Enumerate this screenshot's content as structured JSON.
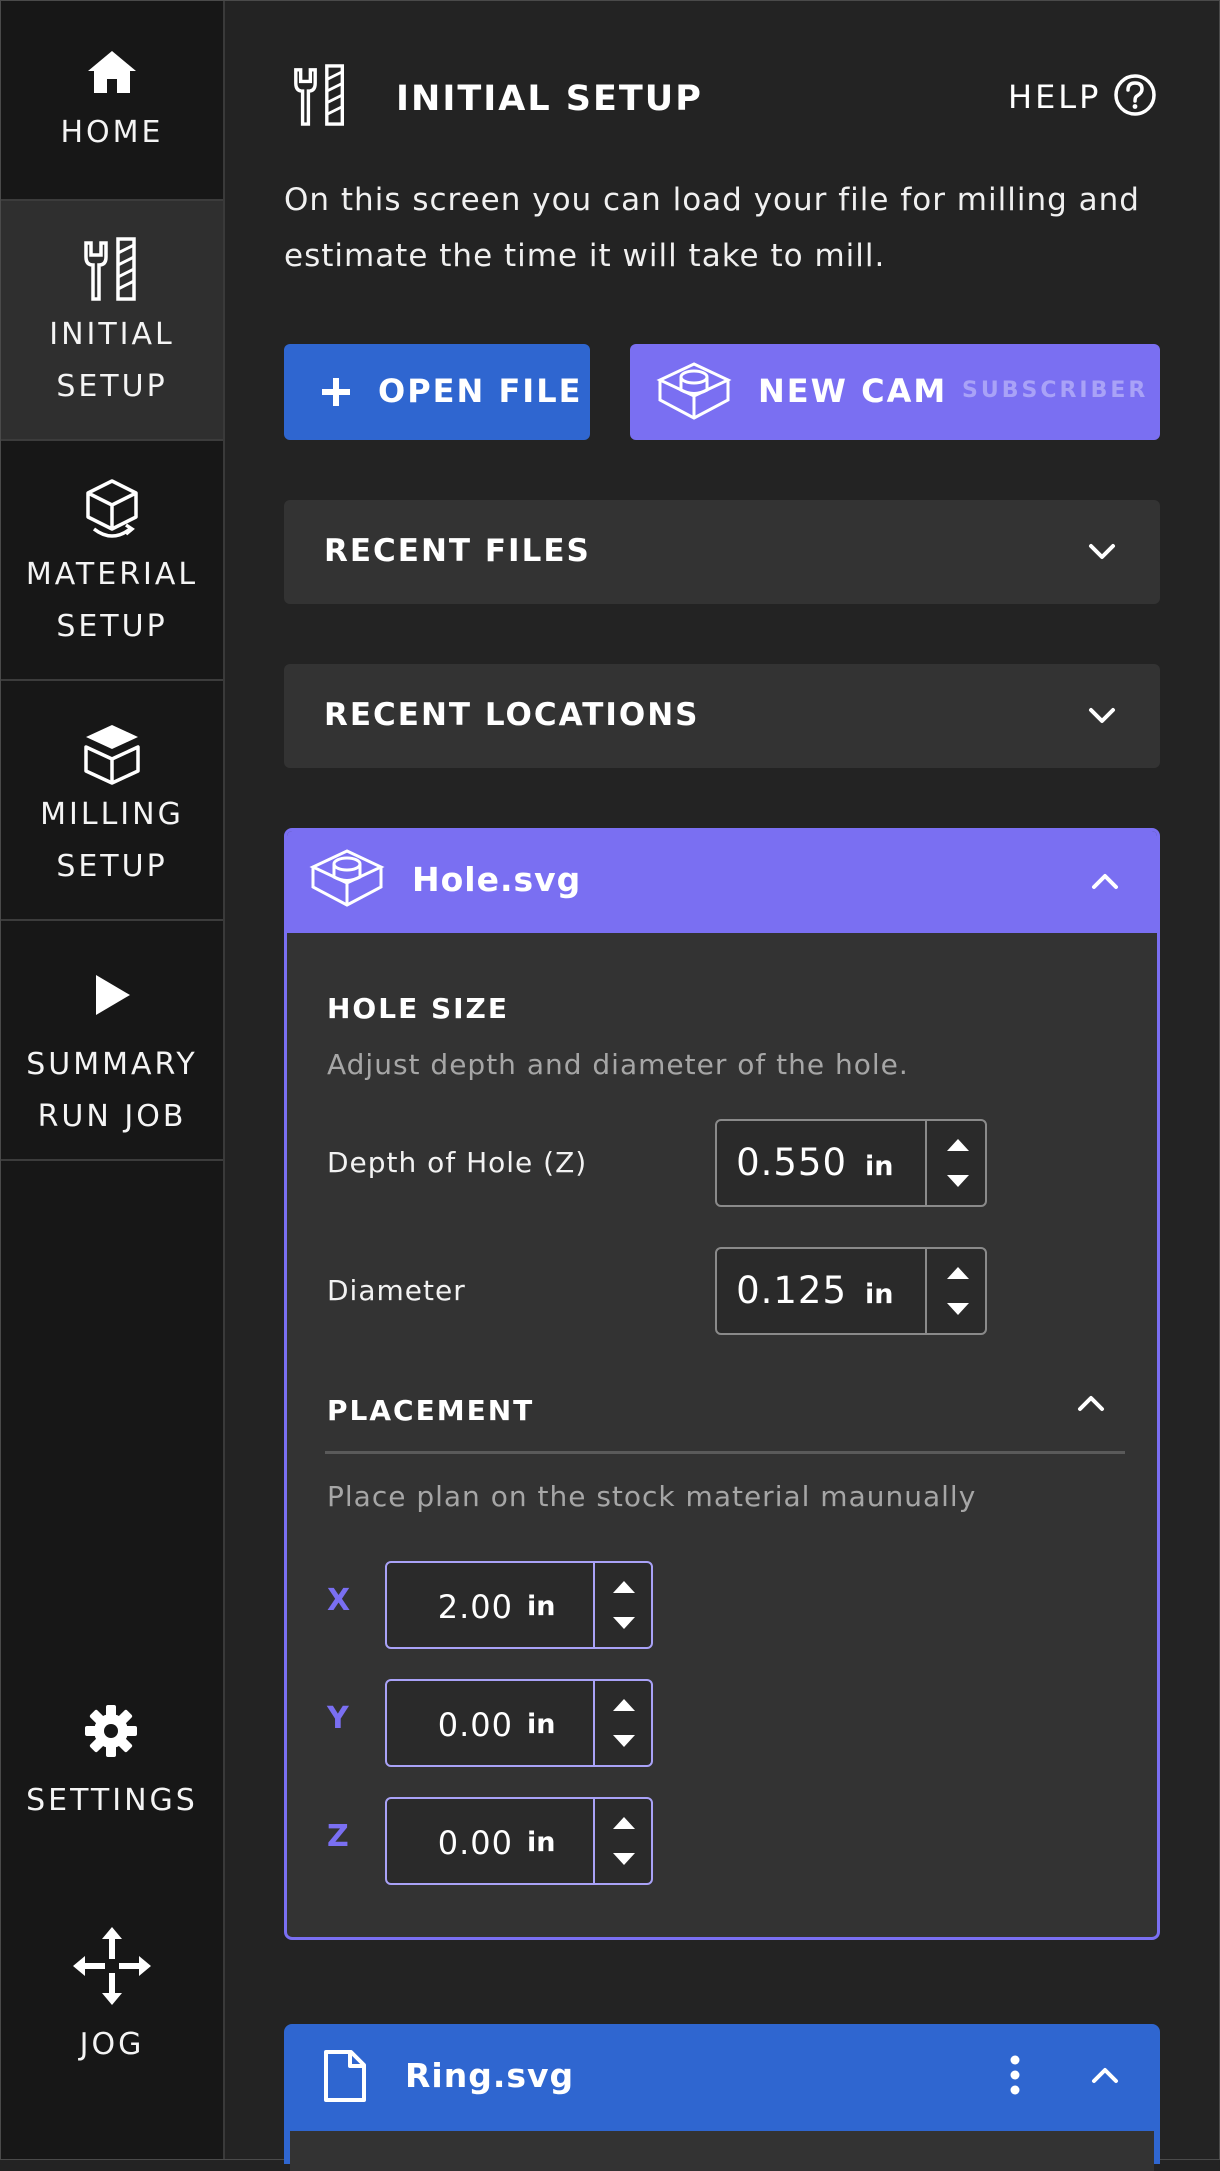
{
  "sidebar": {
    "items": [
      {
        "label_lines": [
          "HOME"
        ],
        "icon": "home-icon"
      },
      {
        "label_lines": [
          "INITIAL",
          "SETUP"
        ],
        "icon": "tools-icon",
        "active": true
      },
      {
        "label_lines": [
          "MATERIAL",
          "SETUP"
        ],
        "icon": "material-cube-icon"
      },
      {
        "label_lines": [
          "MILLING",
          "SETUP"
        ],
        "icon": "milling-cube-icon"
      },
      {
        "label_lines": [
          "SUMMARY",
          "RUN JOB"
        ],
        "icon": "play-icon"
      }
    ],
    "settings_label": "SETTINGS",
    "jog_label": "JOG"
  },
  "header": {
    "title": "INITIAL SETUP",
    "help_label": "HELP",
    "description": "On this screen you can load your file for milling and estimate the time it will take to mill."
  },
  "actions": {
    "open_file_label": "OPEN FILE",
    "new_cam_label": "NEW CAM",
    "subscriber_tag": "SUBSCRIBER"
  },
  "sections": {
    "recent_files_label": "RECENT FILES",
    "recent_locations_label": "RECENT LOCATIONS"
  },
  "hole_card": {
    "file_name": "Hole.svg",
    "hole_size_title": "HOLE SIZE",
    "hole_size_desc": "Adjust depth and diameter of the hole.",
    "depth_label": "Depth of Hole (Z)",
    "depth_value": "0.550",
    "depth_unit": "in",
    "diameter_label": "Diameter",
    "diameter_value": "0.125",
    "diameter_unit": "in",
    "placement_title": "PLACEMENT",
    "placement_desc": "Place plan on the stock material maunually",
    "x_label": "X",
    "x_value": "2.00",
    "x_unit": "in",
    "y_label": "Y",
    "y_value": "0.00",
    "y_unit": "in",
    "z_label": "Z",
    "z_value": "0.00",
    "z_unit": "in"
  },
  "ring_card": {
    "file_name": "Ring.svg"
  },
  "colors": {
    "accent_purple": "#7a6ff2",
    "accent_blue": "#2f66d0",
    "sidebar_bg": "#171717",
    "panel_bg": "#333333"
  }
}
